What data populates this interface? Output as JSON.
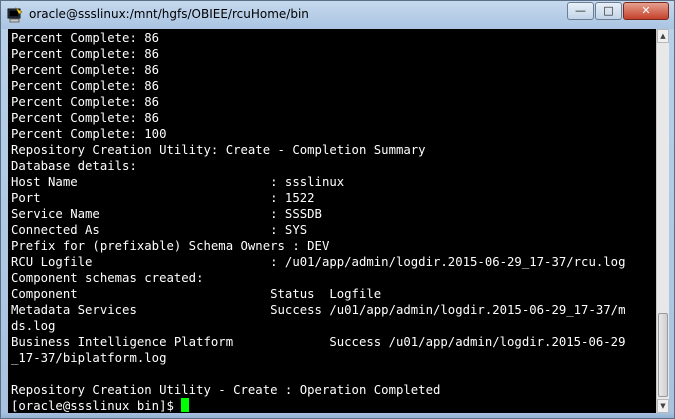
{
  "window": {
    "title": "oracle@ssslinux:/mnt/hgfs/OBIEE/rcuHome/bin",
    "icons": {
      "app": "putty-terminal-icon",
      "minimize": "minimize-icon",
      "maximize": "maximize-icon",
      "close": "close-icon"
    },
    "controls": {
      "minimize_glyph": "—",
      "maximize_glyph": "□",
      "close_glyph": "✕"
    }
  },
  "terminal": {
    "lines": [
      "Percent Complete: 86",
      "Percent Complete: 86",
      "Percent Complete: 86",
      "Percent Complete: 86",
      "Percent Complete: 86",
      "Percent Complete: 86",
      "Percent Complete: 100",
      "Repository Creation Utility: Create - Completion Summary",
      "Database details:",
      "Host Name                          : ssslinux",
      "Port                               : 1522",
      "Service Name                       : SSSDB",
      "Connected As                       : SYS",
      "Prefix for (prefixable) Schema Owners : DEV",
      "RCU Logfile                        : /u01/app/admin/logdir.2015-06-29_17-37/rcu.log",
      "Component schemas created:",
      "Component                          Status  Logfile",
      "Metadata Services                  Success /u01/app/admin/logdir.2015-06-29_17-37/m",
      "ds.log",
      "Business Intelligence Platform             Success /u01/app/admin/logdir.2015-06-29",
      "_17-37/biplatform.log",
      "",
      "Repository Creation Utility - Create : Operation Completed"
    ],
    "prompt": "[oracle@ssslinux bin]$ "
  },
  "colors": {
    "background": "#000000",
    "foreground": "#ffffff",
    "cursor": "#00ff00"
  }
}
